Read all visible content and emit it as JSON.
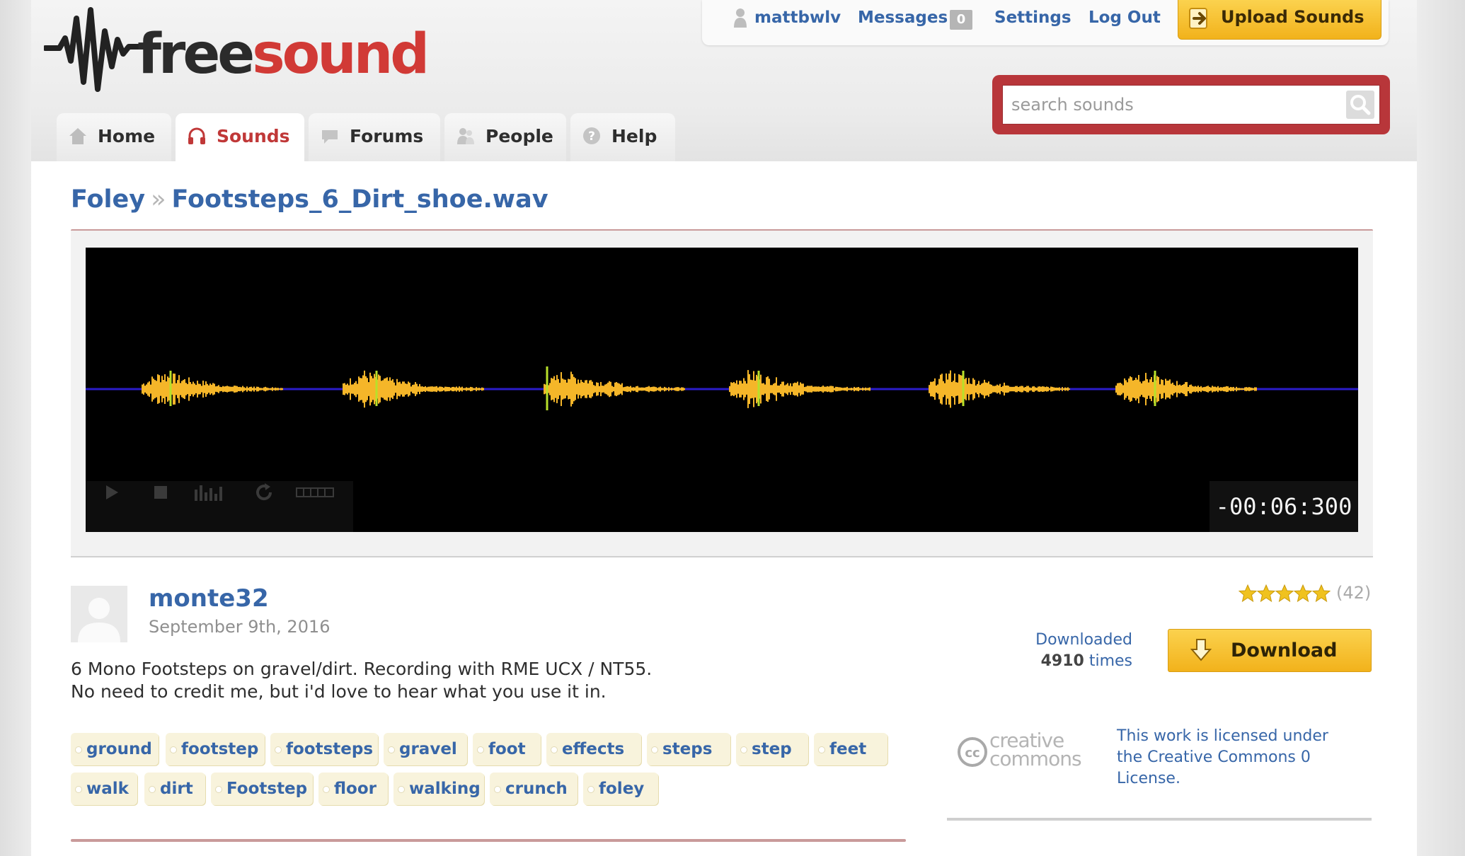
{
  "site": {
    "logo_part1": "free",
    "logo_part2": "sound"
  },
  "userbar": {
    "username": "mattbwlv",
    "messages_label": "Messages",
    "messages_count": "0",
    "settings_label": "Settings",
    "logout_label": "Log Out",
    "upload_label": "Upload Sounds"
  },
  "search": {
    "placeholder": "search sounds"
  },
  "nav": {
    "tabs": [
      {
        "label": "Home",
        "icon": "home-icon"
      },
      {
        "label": "Sounds",
        "icon": "headphones-icon",
        "active": true
      },
      {
        "label": "Forums",
        "icon": "speech-bubble-icon"
      },
      {
        "label": "People",
        "icon": "people-icon"
      },
      {
        "label": "Help",
        "icon": "help-icon"
      }
    ]
  },
  "breadcrumb": {
    "parent": "Foley",
    "separator": "»",
    "current": "Footsteps_6_Dirt_shoe.wav"
  },
  "player": {
    "time_display": "-00:06:300",
    "controls": [
      "play-icon",
      "stop-icon",
      "spectrogram-icon",
      "loop-icon",
      "scale-icon"
    ],
    "colors": {
      "background": "#000000",
      "baseline": "#2b1cc9",
      "wave": "#f5b629",
      "peak": "#b8e02a"
    }
  },
  "sound": {
    "uploader": "monte32",
    "date": "September 9th, 2016",
    "description_lines": [
      "6 Mono Footsteps on gravel/dirt. Recording with RME UCX / NT55.",
      "No need to credit me, but i'd love to hear what you use it in."
    ],
    "tags": [
      "ground",
      "footstep",
      "footsteps",
      "gravel",
      "foot",
      "effects",
      "steps",
      "step",
      "feet",
      "walk",
      "dirt",
      "Footstep",
      "floor",
      "walking",
      "crunch",
      "foley"
    ],
    "rating_stars": 5,
    "rating_count": "(42)",
    "downloaded_prefix": "Downloaded",
    "downloaded_count": "4910",
    "downloaded_suffix": "times",
    "download_label": "Download"
  },
  "license": {
    "lines": [
      "This work is licensed under",
      "the Creative Commons 0",
      "License."
    ],
    "logo_text_top": "creative",
    "logo_text_bottom": "commons"
  },
  "colors": {
    "link": "#3766a8",
    "brand_red": "#d13a36",
    "accent_yellow": "#f2b21b"
  }
}
